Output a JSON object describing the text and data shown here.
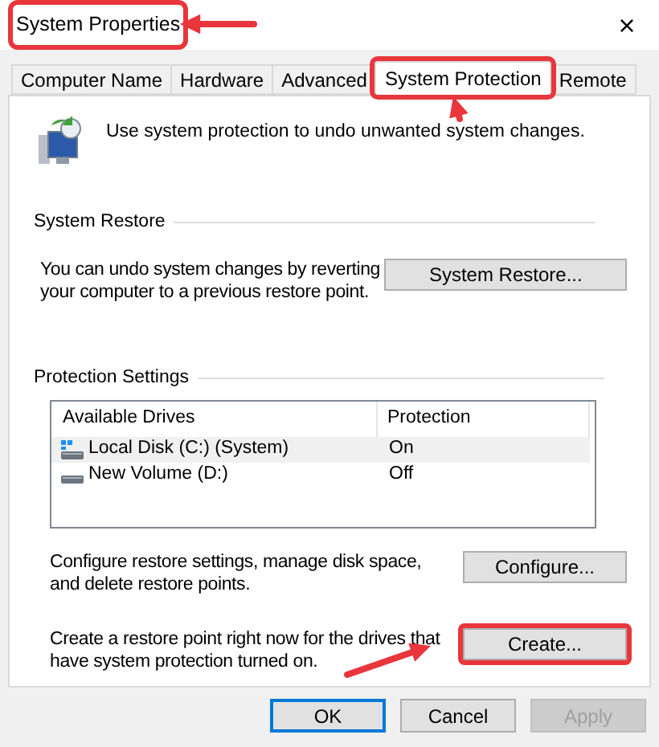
{
  "window": {
    "title": "System Properties",
    "title_highlighted": true,
    "close": "×"
  },
  "tabs": [
    {
      "label": "Computer Name",
      "selected": false,
      "highlighted": false
    },
    {
      "label": "Hardware",
      "selected": false,
      "highlighted": false
    },
    {
      "label": "Advanced",
      "selected": false,
      "highlighted": false
    },
    {
      "label": "System Protection",
      "selected": true,
      "highlighted": true
    },
    {
      "label": "Remote",
      "selected": false,
      "highlighted": false
    }
  ],
  "intro": "Use system protection to undo unwanted system changes.",
  "system_restore": {
    "heading": "System Restore",
    "text": "You can undo system changes by reverting your computer to a previous restore point.",
    "button": "System Restore..."
  },
  "protection_settings": {
    "heading": "Protection Settings",
    "columns": [
      "Available Drives",
      "Protection"
    ],
    "rows": [
      {
        "drive": "Local Disk (C:) (System)",
        "protection": "On",
        "kind": "system",
        "selected": true
      },
      {
        "drive": "New Volume (D:)",
        "protection": "Off",
        "kind": "volume",
        "selected": false
      }
    ],
    "configure_text": "Configure restore settings, manage disk space, and delete restore points.",
    "configure_button": "Configure...",
    "create_text": "Create a restore point right now for the drives that have system protection turned on.",
    "create_button": "Create...",
    "create_highlighted": true
  },
  "buttons": [
    {
      "label": "OK",
      "kind": "default",
      "disabled": false
    },
    {
      "label": "Cancel",
      "kind": "normal",
      "disabled": false
    },
    {
      "label": "Apply",
      "kind": "normal",
      "disabled": true
    }
  ]
}
